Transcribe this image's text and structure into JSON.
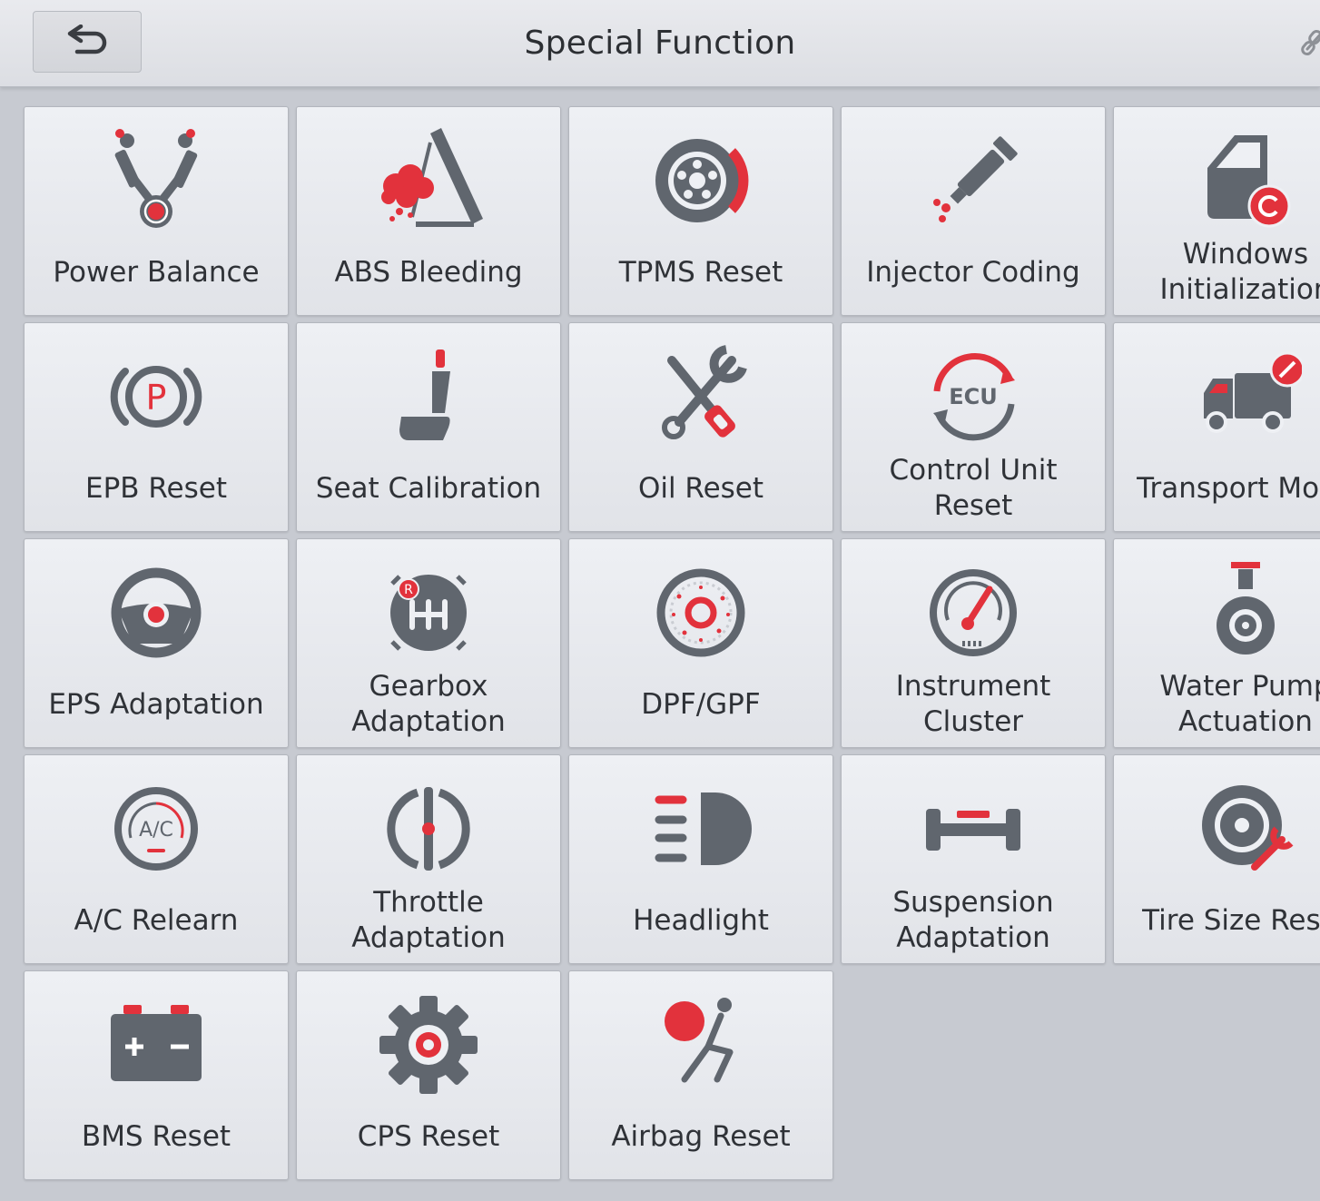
{
  "header": {
    "title": "Special Function",
    "back_icon": "back-arrow-icon",
    "close_icon": "disconnect-icon"
  },
  "colors": {
    "accent": "#e2323c",
    "icon_gray": "#5d636b",
    "background": "#c7cad1"
  },
  "tiles": [
    {
      "label": "Power Balance",
      "icon": "power-balance-icon"
    },
    {
      "label": "ABS Bleeding",
      "icon": "abs-bleeding-icon"
    },
    {
      "label": "TPMS Reset",
      "icon": "tpms-icon"
    },
    {
      "label": "Injector Coding",
      "icon": "injector-icon"
    },
    {
      "label": "Windows\nInitialization",
      "icon": "window-door-icon"
    },
    {
      "label": "EPB Reset",
      "icon": "epb-icon"
    },
    {
      "label": "Seat Calibration",
      "icon": "seat-icon"
    },
    {
      "label": "Oil Reset",
      "icon": "oil-wrench-icon"
    },
    {
      "label": "Control Unit\nReset",
      "icon": "ecu-icon"
    },
    {
      "label": "Transport Mode",
      "icon": "truck-icon"
    },
    {
      "label": "EPS Adaptation",
      "icon": "steering-wheel-icon"
    },
    {
      "label": "Gearbox\nAdaptation",
      "icon": "gearbox-icon"
    },
    {
      "label": "DPF/GPF",
      "icon": "dpf-icon"
    },
    {
      "label": "Instrument\nCluster",
      "icon": "gauge-icon"
    },
    {
      "label": "Water Pump\nActuation",
      "icon": "water-pump-icon"
    },
    {
      "label": "A/C Relearn",
      "icon": "ac-icon"
    },
    {
      "label": "Throttle\nAdaptation",
      "icon": "throttle-icon"
    },
    {
      "label": "Headlight",
      "icon": "headlight-icon"
    },
    {
      "label": "Suspension\nAdaptation",
      "icon": "suspension-icon"
    },
    {
      "label": "Tire Size Reset",
      "icon": "tire-icon"
    },
    {
      "label": "BMS Reset",
      "icon": "battery-icon"
    },
    {
      "label": "CPS Reset",
      "icon": "gear-icon"
    },
    {
      "label": "Airbag Reset",
      "icon": "airbag-icon"
    }
  ]
}
